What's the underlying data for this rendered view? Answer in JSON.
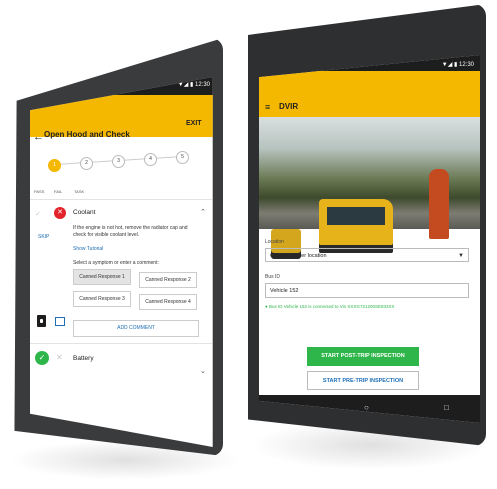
{
  "left_tablet": {
    "status_time": "▼◢ ▮ 12:30",
    "header": {
      "back_icon": "arrow-left-icon",
      "title": "Open Hood and Check",
      "exit_label": "EXIT"
    },
    "stepper": {
      "steps": [
        "1",
        "2",
        "3",
        "4",
        "5"
      ],
      "active_step": 1
    },
    "columns": {
      "pass": "PASS",
      "fail": "FAIL",
      "task": "TASK"
    },
    "task": {
      "title": "Coolant",
      "description": "If the engine is not hot, remove the radiator cap and check for visible coolant level.",
      "show_tutorial": "Show Tutorial",
      "skip": "SKIP",
      "prompt": "Select a symptom or enter a comment:",
      "canned_responses": [
        "Canned Response 1",
        "Canned Response 2",
        "Canned Response 3",
        "Canned Response 4"
      ],
      "selected_response": "Canned Response 1",
      "add_comment": "ADD COMMENT"
    },
    "next_task": {
      "title": "Battery"
    }
  },
  "right_tablet": {
    "status_time": "▼◢ ▮ 12:30",
    "header": {
      "menu_icon": "hamburger-icon",
      "title": "DVIR"
    },
    "location": {
      "label": "Location",
      "value": "Choose carrier location"
    },
    "bus_id": {
      "label": "Bus ID",
      "value": "Vehicle 152"
    },
    "connection_status": "Bus ID Vehicle 152 is connected to Vin XXXG721200SE833XX",
    "buttons": {
      "post_trip": "START POST-TRIP INSPECTION",
      "pre_trip": "START PRE-TRIP INSPECTION"
    },
    "nav": {
      "back": "◁",
      "home": "○",
      "recent": "□"
    }
  },
  "colors": {
    "accent": "#f5b800",
    "pass": "#2fb64a",
    "fail": "#e2232a",
    "link": "#1f6fb5"
  }
}
